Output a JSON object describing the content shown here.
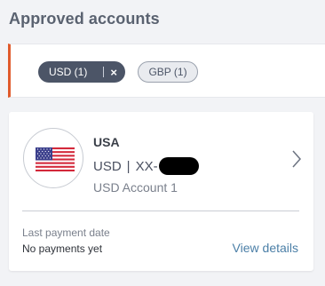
{
  "page": {
    "title": "Approved accounts"
  },
  "filters": {
    "chips": [
      {
        "label": "USD (1)",
        "active": true,
        "remove_symbol": "×"
      },
      {
        "label": "GBP (1)",
        "active": false
      }
    ],
    "accent_color": "#e05a2b"
  },
  "account_card": {
    "flag_icon": "us-flag-icon",
    "country": "USA",
    "currency": "USD",
    "separator": "|",
    "number_prefix": "XX-",
    "account_name": "USD Account 1",
    "chevron_icon": "chevron-right-icon",
    "last_payment_label": "Last payment date",
    "last_payment_value": "No payments yet",
    "view_details_label": "View details",
    "link_color": "#4b7fa7"
  }
}
